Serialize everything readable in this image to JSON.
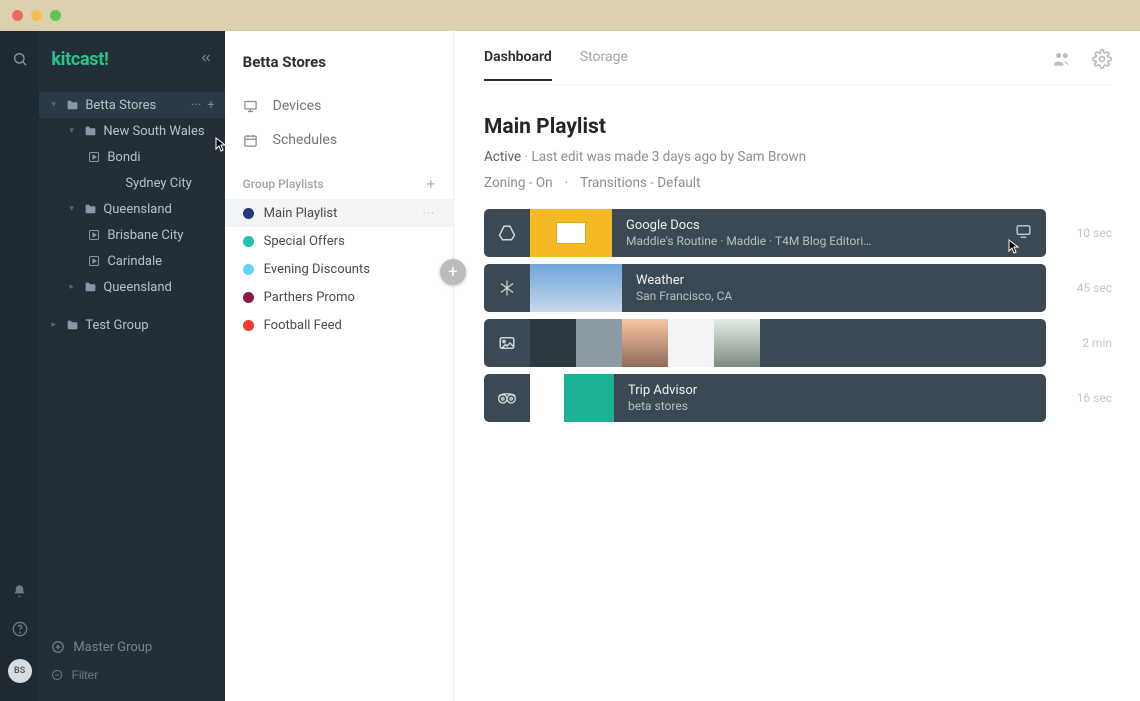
{
  "os": {
    "colors": {
      "red": "#ed6a5e",
      "yellow": "#f5bf4f",
      "green": "#61c454"
    }
  },
  "brand": {
    "logo": "kitcast!"
  },
  "rail": {
    "avatar_initials": "BS"
  },
  "tree": {
    "rows": [
      {
        "kind": "group",
        "label": "Betta Stores",
        "depth": 0,
        "expanded": true,
        "selected": true,
        "showControls": true,
        "icon": "folder"
      },
      {
        "kind": "folder",
        "label": "New South Wales",
        "depth": 1,
        "expanded": true,
        "icon": "folder"
      },
      {
        "kind": "item",
        "label": "Bondi",
        "depth": 2,
        "icon": "play"
      },
      {
        "kind": "item",
        "label": "Sydney City",
        "depth": 3,
        "icon": "none"
      },
      {
        "kind": "folder",
        "label": "Queensland",
        "depth": 1,
        "expanded": true,
        "icon": "folder"
      },
      {
        "kind": "item",
        "label": "Brisbane City",
        "depth": 2,
        "icon": "play"
      },
      {
        "kind": "item",
        "label": "Carindale",
        "depth": 2,
        "icon": "play"
      },
      {
        "kind": "folder",
        "label": "Queensland",
        "depth": 1,
        "expanded": false,
        "icon": "folder"
      },
      {
        "kind": "group",
        "label": "Test Group",
        "depth": 0,
        "expanded": false,
        "icon": "folder"
      }
    ]
  },
  "sidebar_bottom": {
    "master_group": "Master Group",
    "filter_placeholder": "Filter"
  },
  "col2": {
    "header": "Betta Stores",
    "nav": [
      {
        "icon": "monitor",
        "label": "Devices"
      },
      {
        "icon": "schedule",
        "label": "Schedules"
      }
    ],
    "playlist_section_label": "Group Playlists",
    "playlists": [
      {
        "color": "#1f3a78",
        "name": "Main Playlist",
        "active": true,
        "showMore": true
      },
      {
        "color": "#1fc1b3",
        "name": "Special Offers"
      },
      {
        "color": "#66d3f2",
        "name": "Evening Discounts"
      },
      {
        "color": "#8b1a4a",
        "name": "Parthers Promo"
      },
      {
        "color": "#f23c2e",
        "name": "Football Feed"
      }
    ]
  },
  "tabs": {
    "items": [
      {
        "label": "Dashboard",
        "active": true
      },
      {
        "label": "Storage",
        "active": false
      }
    ]
  },
  "page": {
    "title": "Main Playlist",
    "status": "Active",
    "last_edit": "Last edit was made 3 days ago by Sam Brown",
    "zoning": "Zoning - On",
    "transitions": "Transitions - Default"
  },
  "cards": [
    {
      "icon": "drive",
      "title": "Google Docs",
      "subtitle": "Maddie's Routine · Maddie · T4M Blog Editori…",
      "thumbs": [
        "gdocs"
      ],
      "duration": "10 sec",
      "showMonitorIcon": true,
      "cursor": true
    },
    {
      "icon": "snowflake",
      "title": "Weather",
      "subtitle": "San Francisco, CA",
      "thumbs": [
        "sky",
        "sky"
      ],
      "duration": "45 sec"
    },
    {
      "icon": "image",
      "title": "",
      "subtitle": "",
      "thumbs": [
        "dark",
        "grey",
        "sunset",
        "white",
        "forest"
      ],
      "duration": "2 min"
    },
    {
      "icon": "tripadvisor",
      "title": "Trip Advisor",
      "subtitle": "beta stores",
      "thumbs": [
        "trip"
      ],
      "duration": "16 sec"
    }
  ]
}
